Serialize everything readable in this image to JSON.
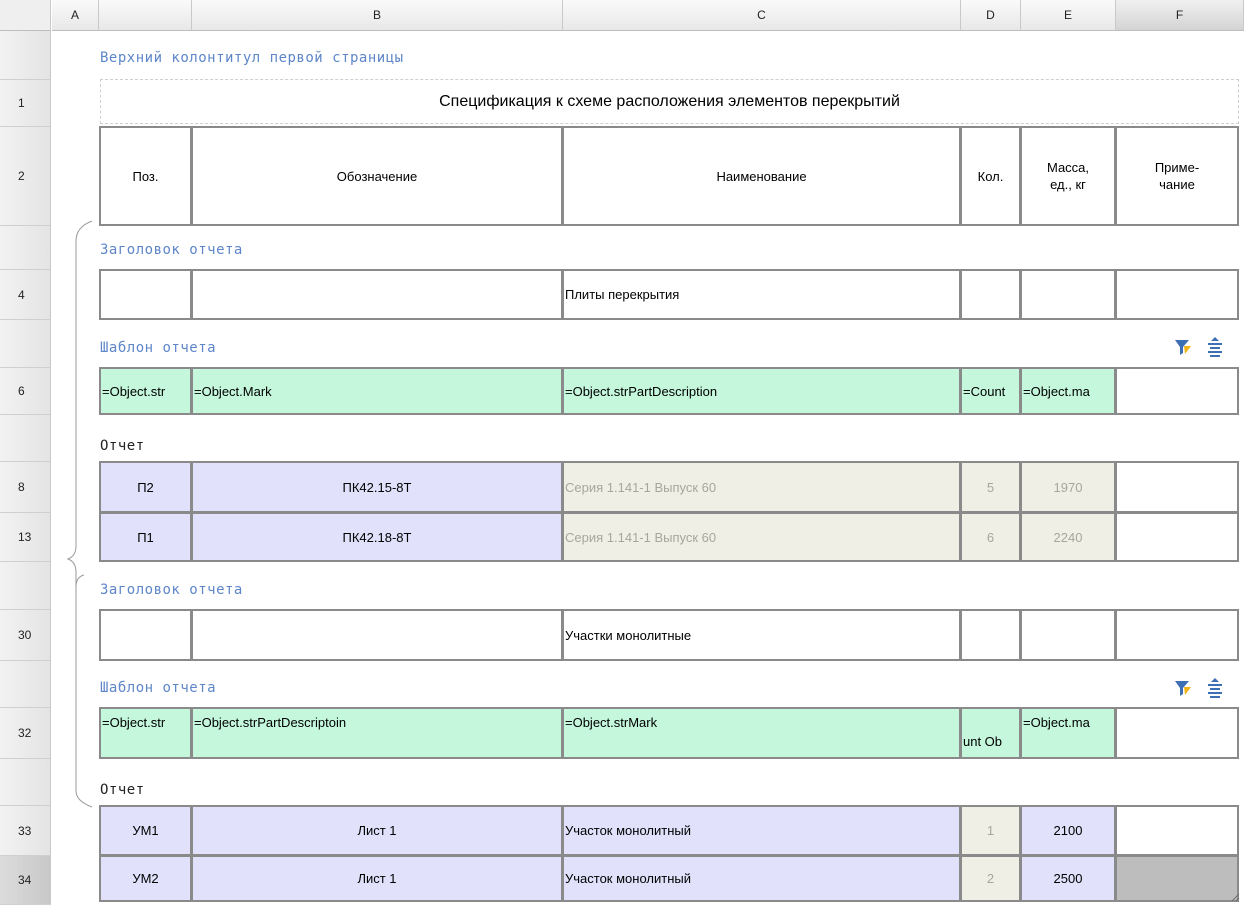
{
  "columns": [
    "A",
    "B",
    "C",
    "D",
    "E",
    "F"
  ],
  "rows": [
    "1",
    "2",
    "4",
    "6",
    "8",
    "13",
    "30",
    "32",
    "33",
    "34"
  ],
  "page_header_label": "Верхний колонтитул первой страницы",
  "title": "Спецификация к схеме расположения элементов перекрытий",
  "table_header": [
    "Поз.",
    "Обозначение",
    "Наименование",
    "Кол.",
    "Масса, ед., кг",
    "Приме- чание"
  ],
  "sections": [
    {
      "header_label": "Заголовок отчета",
      "header_row": [
        "",
        "",
        "Плиты перекрытия",
        "",
        "",
        ""
      ],
      "template_label": "Шаблон отчета",
      "template_row": [
        "=Object.str",
        "=Object.Mark",
        "=Object.strPartDescription",
        "=Count",
        "=Object.ma",
        ""
      ],
      "report_label": "Отчет",
      "report_rows": [
        [
          "П2",
          "ПК42.15-8Т",
          "Серия 1.141-1 Выпуск 60",
          "5",
          "1970",
          ""
        ],
        [
          "П1",
          "ПК42.18-8Т",
          "Серия 1.141-1 Выпуск 60",
          "6",
          "2240",
          ""
        ]
      ]
    },
    {
      "header_label": "Заголовок отчета",
      "header_row": [
        "",
        "",
        "Участки монолитные",
        "",
        "",
        ""
      ],
      "template_label": "Шаблон отчета",
      "template_row": [
        "=Object.str",
        "=Object.strPartDescriptoin",
        "=Object.strMark",
        "unt Ob",
        "=Object.ma",
        ""
      ],
      "report_label": "Отчет",
      "report_rows": [
        [
          "УМ1",
          "Лист 1",
          "Участок монолитный",
          "1",
          "2100",
          ""
        ],
        [
          "УМ2",
          "Лист 1",
          "Участок монолитный",
          "2",
          "2500",
          ""
        ]
      ]
    }
  ],
  "icons": {
    "filter": "filter-icon",
    "sort": "sort-icon"
  }
}
